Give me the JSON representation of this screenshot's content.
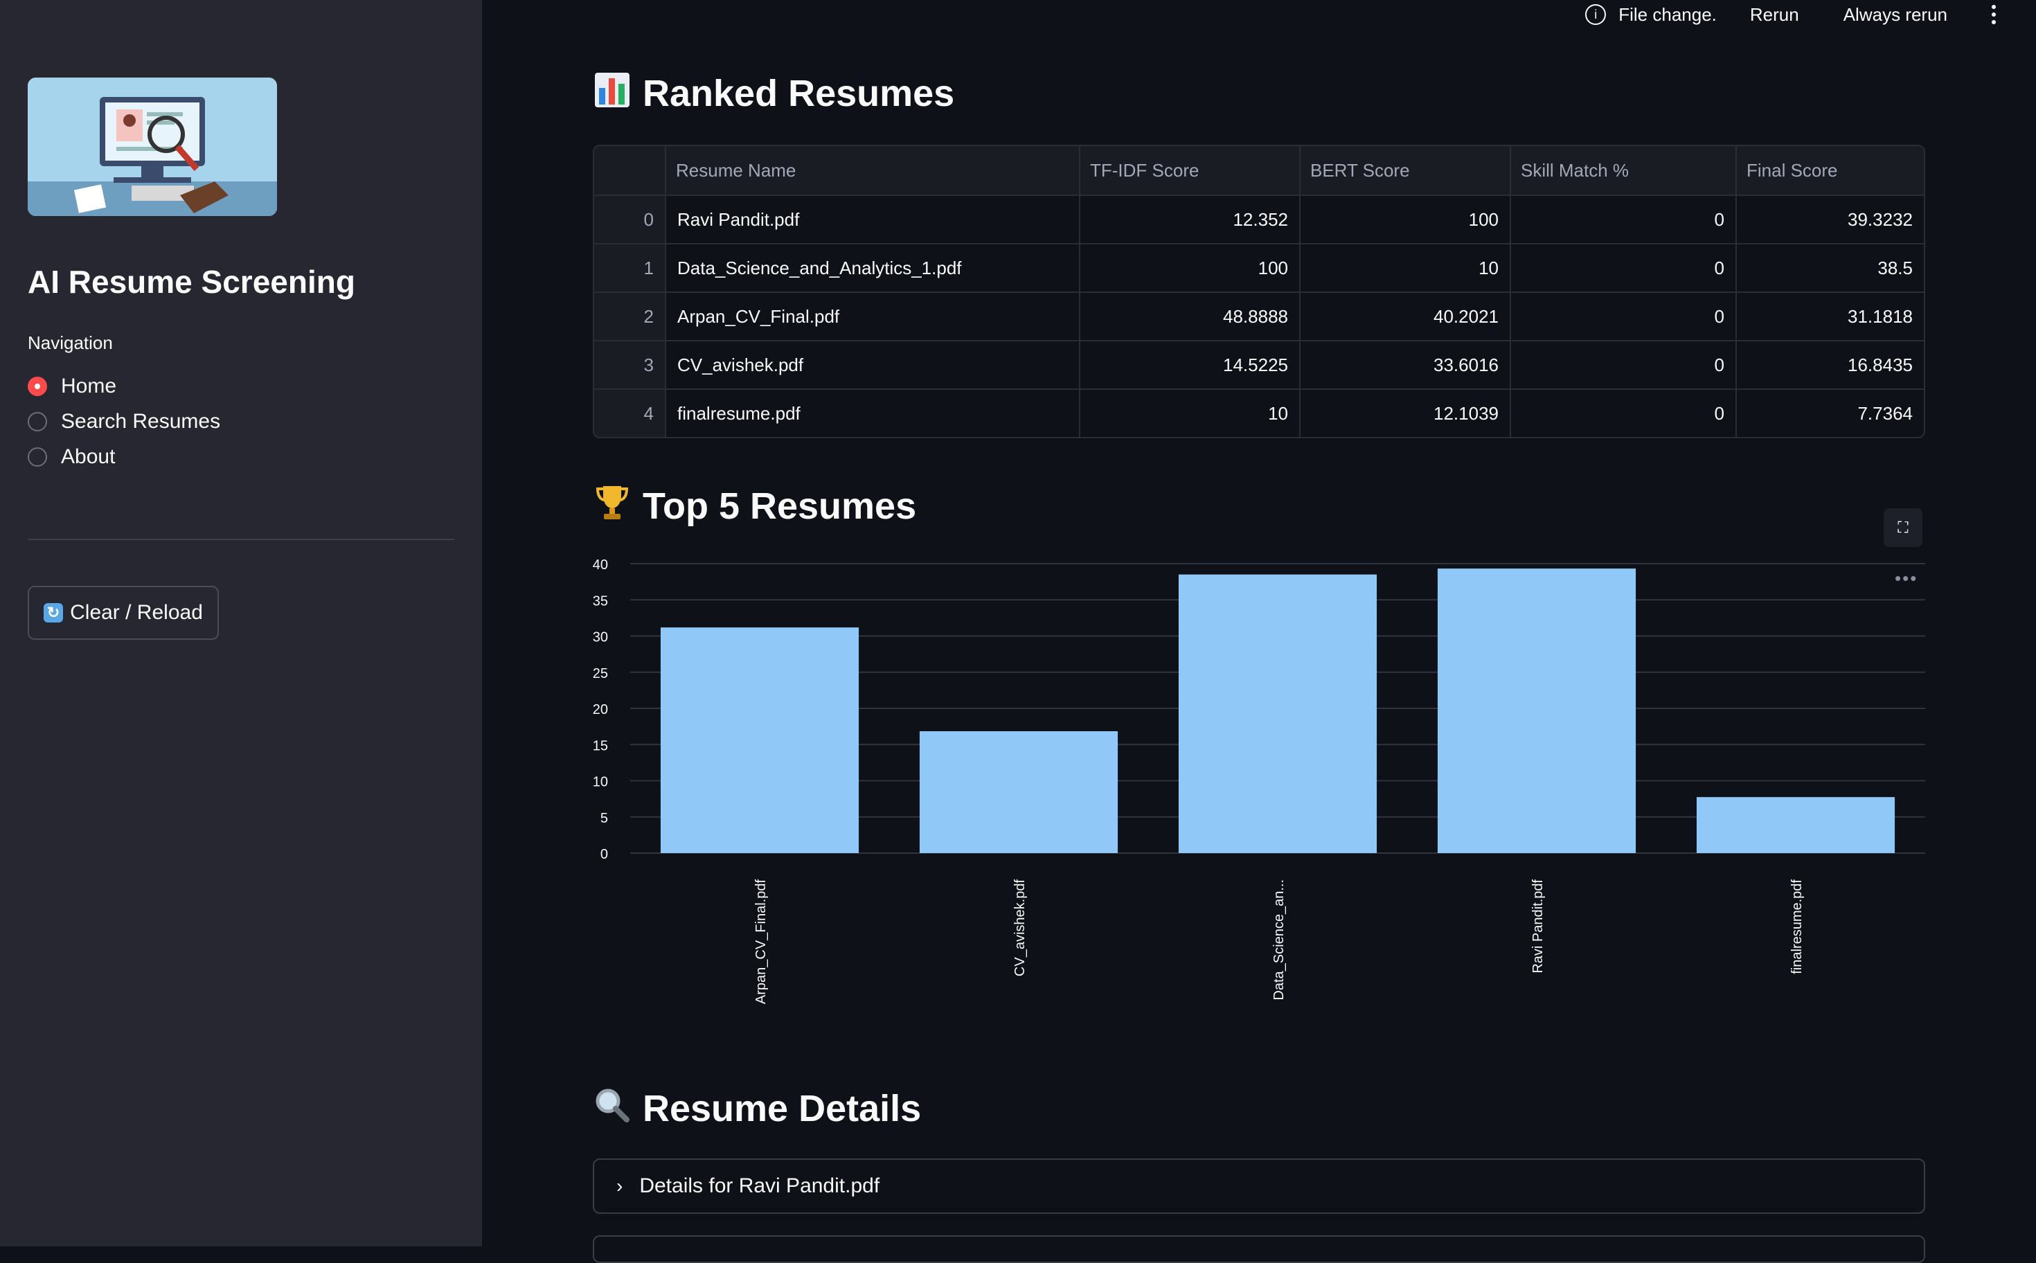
{
  "toolbar": {
    "status": "File change.",
    "rerun": "Rerun",
    "always_rerun": "Always rerun"
  },
  "sidebar": {
    "title": "AI Resume Screening",
    "nav_label": "Navigation",
    "nav_items": [
      {
        "label": "Home",
        "selected": true
      },
      {
        "label": "Search Resumes",
        "selected": false
      },
      {
        "label": "About",
        "selected": false
      }
    ],
    "clear_button": "Clear / Reload"
  },
  "sections": {
    "ranked": "Ranked Resumes",
    "top5": "Top 5 Resumes",
    "details": "Resume Details"
  },
  "table": {
    "headers": [
      "",
      "Resume Name",
      "TF-IDF Score",
      "BERT Score",
      "Skill Match %",
      "Final Score"
    ],
    "rows": [
      [
        "0",
        "Ravi Pandit.pdf",
        "12.352",
        "100",
        "0",
        "39.3232"
      ],
      [
        "1",
        "Data_Science_and_Analytics_1.pdf",
        "100",
        "10",
        "0",
        "38.5"
      ],
      [
        "2",
        "Arpan_CV_Final.pdf",
        "48.8888",
        "40.2021",
        "0",
        "31.1818"
      ],
      [
        "3",
        "CV_avishek.pdf",
        "14.5225",
        "33.6016",
        "0",
        "16.8435"
      ],
      [
        "4",
        "finalresume.pdf",
        "10",
        "12.1039",
        "0",
        "7.7364"
      ]
    ]
  },
  "chart_data": {
    "type": "bar",
    "categories": [
      "Arpan_CV_Final.pdf",
      "CV_avishek.pdf",
      "Data_Science_an...",
      "Ravi Pandit.pdf",
      "finalresume.pdf"
    ],
    "values": [
      31.1818,
      16.8435,
      38.5,
      39.3232,
      7.7364
    ],
    "yticks": [
      0,
      5,
      10,
      15,
      20,
      25,
      30,
      35,
      40
    ],
    "ylim": [
      0,
      40
    ],
    "color": "#90c8f8",
    "grid": true
  },
  "expander": {
    "label": "Details for Ravi Pandit.pdf"
  },
  "colors": {
    "background": "#0e1117",
    "sidebar": "#262730",
    "accent": "#ff4b4b",
    "bar": "#90c8f8"
  }
}
